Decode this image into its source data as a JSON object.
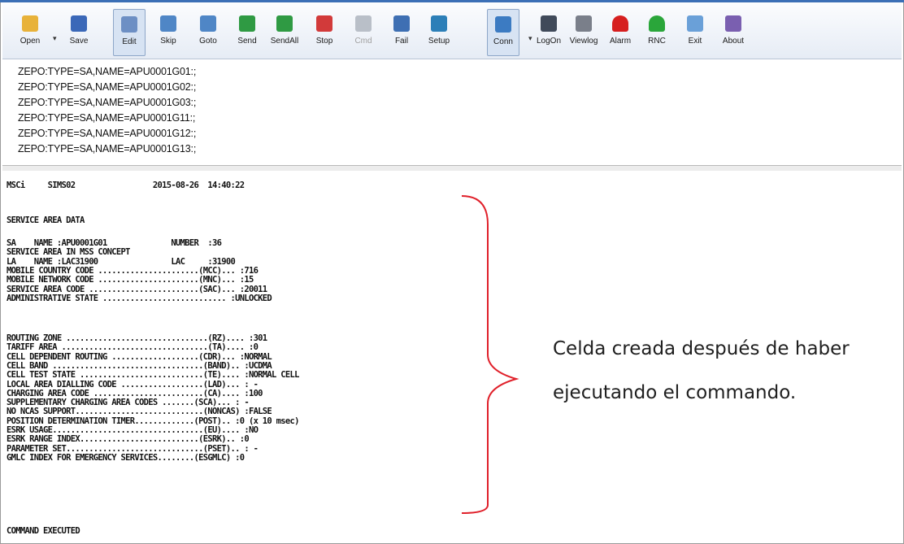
{
  "toolbar": {
    "buttons": [
      {
        "label": "Open",
        "icon": "open-folder-icon",
        "color": "#e8b23a"
      },
      {
        "label": "Save",
        "icon": "save-disk-icon",
        "color": "#3b68b8"
      },
      {
        "label": "Edit",
        "icon": "edit-icon",
        "color": "#6d8fc4"
      },
      {
        "label": "Skip",
        "icon": "skip-icon",
        "color": "#4f86c6"
      },
      {
        "label": "Goto",
        "icon": "goto-icon",
        "color": "#4f86c6"
      },
      {
        "label": "Send",
        "icon": "send-icon",
        "color": "#2f9a43"
      },
      {
        "label": "SendAll",
        "icon": "send-all-icon",
        "color": "#2f9a43"
      },
      {
        "label": "Stop",
        "icon": "stop-icon",
        "color": "#d23a3a"
      },
      {
        "label": "Cmd",
        "icon": "cmd-icon",
        "color": "#b9bfc8"
      },
      {
        "label": "Fail",
        "icon": "fail-icon",
        "color": "#3e6fb3"
      },
      {
        "label": "Setup",
        "icon": "setup-icon",
        "color": "#2c7fb8"
      },
      {
        "label": "Conn",
        "icon": "connection-icon",
        "color": "#3c7bc2"
      },
      {
        "label": "LogOn",
        "icon": "logon-icon",
        "color": "#404a5a"
      },
      {
        "label": "Viewlog",
        "icon": "viewlog-icon",
        "color": "#7a7f8a"
      },
      {
        "label": "Alarm",
        "icon": "red-alarm-icon",
        "color": "#d61f1f"
      },
      {
        "label": "RNC",
        "icon": "green-alarm-icon",
        "color": "#2aa63a"
      },
      {
        "label": "Exit",
        "icon": "exit-icon",
        "color": "#6aa0d8"
      },
      {
        "label": "About",
        "icon": "about-icon",
        "color": "#7a5fb0"
      }
    ]
  },
  "commands": [
    "ZEPO:TYPE=SA,NAME=APU0001G01:;",
    "ZEPO:TYPE=SA,NAME=APU0001G02:;",
    "ZEPO:TYPE=SA,NAME=APU0001G03:;",
    "ZEPO:TYPE=SA,NAME=APU0001G11:;",
    "ZEPO:TYPE=SA,NAME=APU0001G12:;",
    "ZEPO:TYPE=SA,NAME=APU0001G13:;"
  ],
  "output": {
    "header": "MSCi     SIMS02                 2015-08-26  14:40:22",
    "title": "SERVICE AREA DATA",
    "block1": [
      "SA    NAME :APU0001G01              NUMBER  :36",
      "SERVICE AREA IN MSS CONCEPT",
      "LA    NAME :LAC31900                LAC     :31900",
      "MOBILE COUNTRY CODE ......................(MCC)... :716",
      "MOBILE NETWORK CODE ......................(MNC)... :15",
      "SERVICE AREA CODE ........................(SAC)... :20011",
      "ADMINISTRATIVE STATE ........................... :UNLOCKED"
    ],
    "block2": [
      "ROUTING ZONE ...............................(RZ).... :301",
      "TARIFF AREA ................................(TA).... :0",
      "CELL DEPENDENT ROUTING ...................(CDR)... :NORMAL",
      "CELL BAND .................................(BAND).. :UCDMA",
      "CELL TEST STATE ...........................(TE).... :NORMAL CELL",
      "LOCAL AREA DIALLING CODE ..................(LAD)... : -",
      "CHARGING AREA CODE ........................(CA).... :100",
      "SUPPLEMENTARY CHARGING AREA CODES .......(SCA)... : -",
      "NO NCAS SUPPORT............................(NONCAS) :FALSE",
      "POSITION DETERMINATION TIMER.............(POST).. :0 (x 10 msec)",
      "ESRK USAGE.................................(EU).... :NO",
      "ESRK RANGE INDEX..........................(ESRK).. :0",
      "PARAMETER SET..............................(PSET).. : -",
      "GMLC INDEX FOR EMERGENCY SERVICES........(ESGMLC) :0"
    ],
    "footer": "COMMAND EXECUTED"
  },
  "annotation": {
    "line1": "Celda creada después de haber",
    "line2": "ejecutando el commando.",
    "bracket_color": "#e0202a"
  }
}
